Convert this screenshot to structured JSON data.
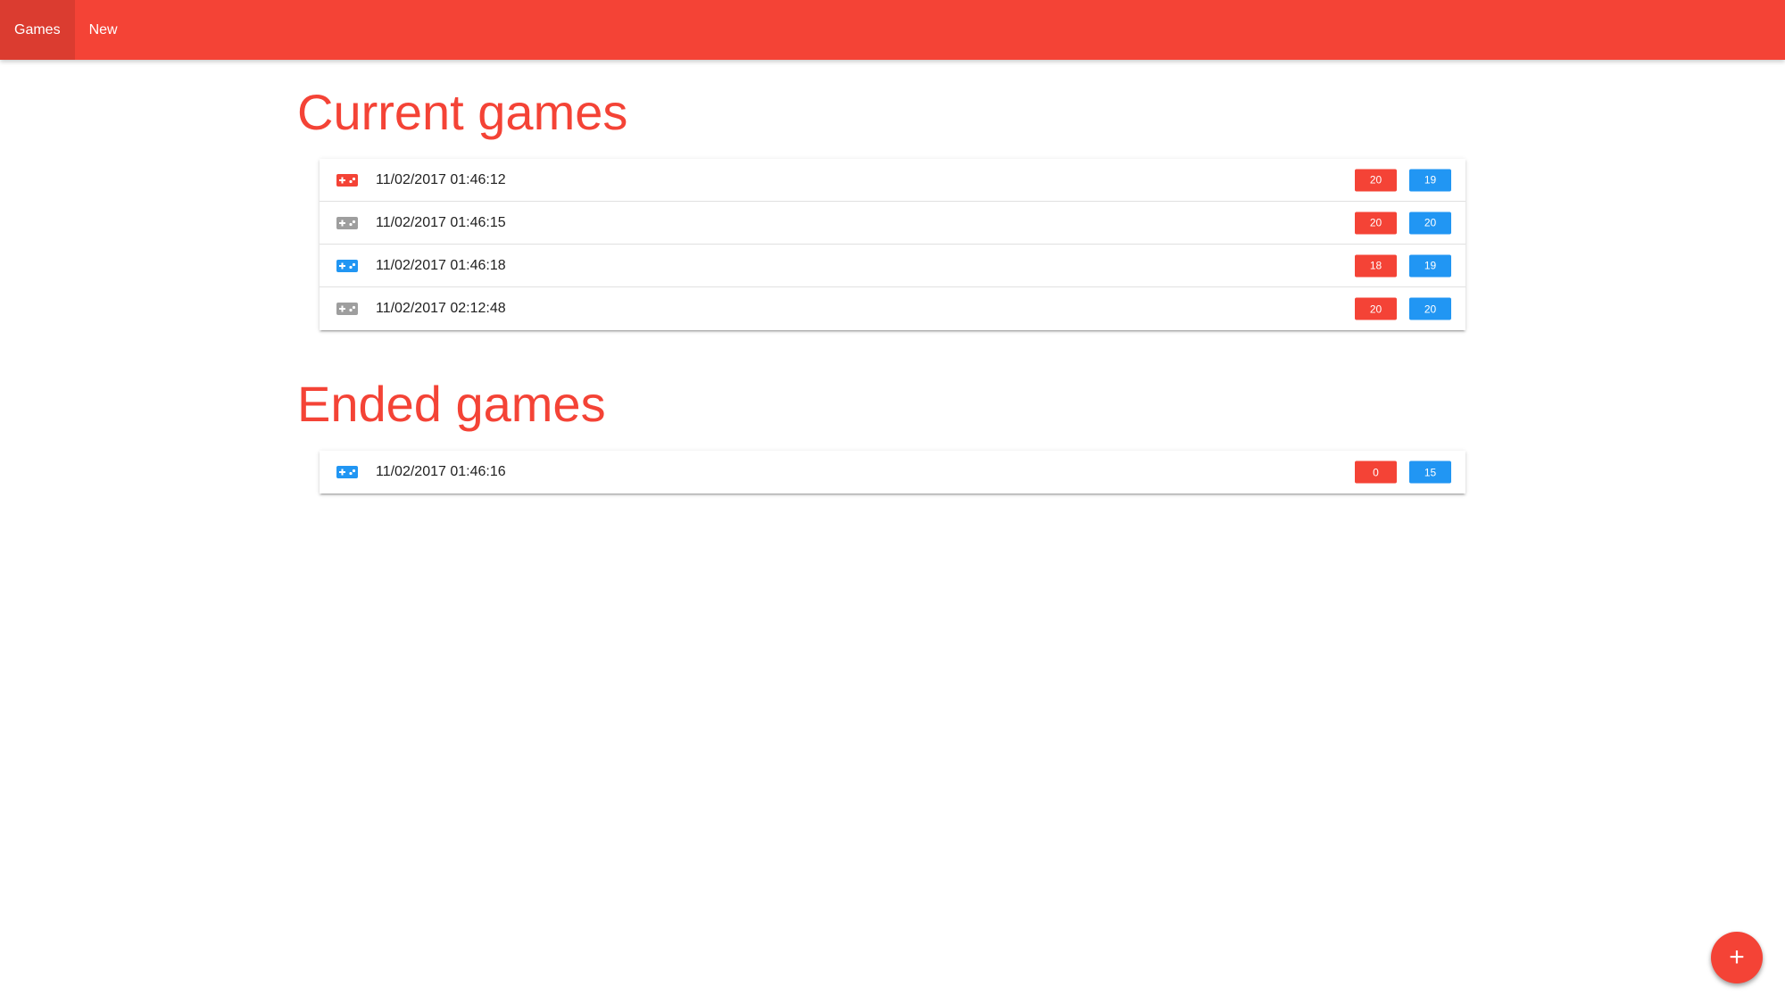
{
  "nav": {
    "items": [
      {
        "label": "Games",
        "active": true
      },
      {
        "label": "New",
        "active": false
      }
    ]
  },
  "colors": {
    "primary": "#f44336",
    "blue": "#2196f3",
    "grey": "#9e9e9e"
  },
  "current": {
    "title": "Current games",
    "games": [
      {
        "time": "11/02/2017 01:46:12",
        "icon": "gamepad-icon",
        "icon_color": "red",
        "red": "20",
        "blue": "19"
      },
      {
        "time": "11/02/2017 01:46:15",
        "icon": "gamepad-icon",
        "icon_color": "grey",
        "red": "20",
        "blue": "20"
      },
      {
        "time": "11/02/2017 01:46:18",
        "icon": "gamepad-icon",
        "icon_color": "blue",
        "red": "18",
        "blue": "19"
      },
      {
        "time": "11/02/2017 02:12:48",
        "icon": "gamepad-icon",
        "icon_color": "grey",
        "red": "20",
        "blue": "20"
      }
    ]
  },
  "ended": {
    "title": "Ended games",
    "games": [
      {
        "time": "11/02/2017 01:46:16",
        "icon": "gamepad-icon",
        "icon_color": "blue",
        "red": "0",
        "blue": "15"
      }
    ]
  },
  "fab": {
    "label": "+",
    "icon": "add-icon"
  }
}
